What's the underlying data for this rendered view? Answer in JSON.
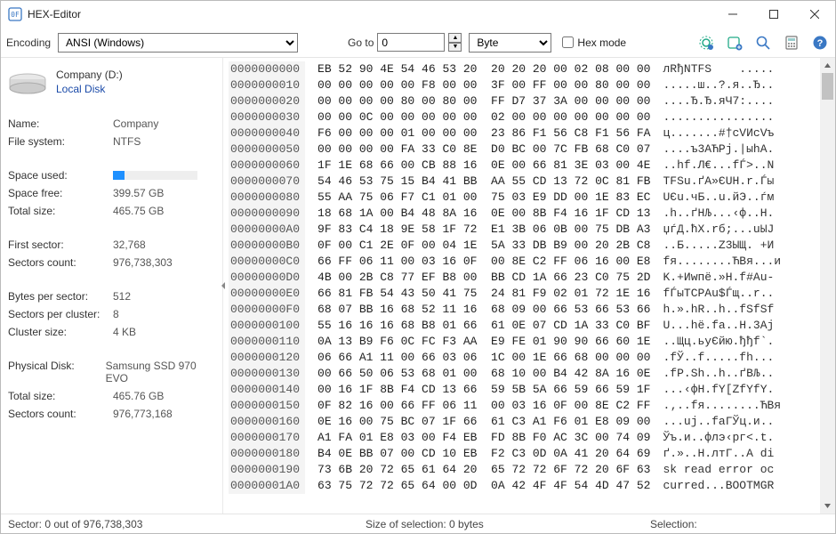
{
  "title": "HEX-Editor",
  "toolbar": {
    "encoding_label": "Encoding",
    "encoding_value": "ANSI (Windows)",
    "goto_label": "Go to",
    "goto_value": "0",
    "byte_value": "Byte",
    "hexmode_label": "Hex mode",
    "icons": {
      "settings": "settings-gear-icon",
      "settings2": "settings-plus-icon",
      "search": "search-icon",
      "calc": "calc-icon",
      "help": "help-icon"
    }
  },
  "left": {
    "disk_title": "Company (D:)",
    "disk_type": "Local Disk",
    "name_k": "Name:",
    "name_v": "Company",
    "fs_k": "File system:",
    "fs_v": "NTFS",
    "used_k": "Space used:",
    "used_pct": 14,
    "free_k": "Space free:",
    "free_v": "399.57 GB",
    "total_k": "Total size:",
    "total_v": "465.75 GB",
    "firstsec_k": "First sector:",
    "firstsec_v": "32,768",
    "seccount_k": "Sectors count:",
    "seccount_v": "976,738,303",
    "bps_k": "Bytes per sector:",
    "bps_v": "512",
    "spc_k": "Sectors per cluster:",
    "spc_v": "8",
    "cluster_k": "Cluster size:",
    "cluster_v": "4 KB",
    "phys_k": "Physical Disk:",
    "phys_v": "Samsung SSD 970 EVO",
    "phystotal_k": "Total size:",
    "phystotal_v": "465.76 GB",
    "physseccount_k": "Sectors count:",
    "physseccount_v": "976,773,168"
  },
  "hex": {
    "rows": [
      {
        "o": "0000000000",
        "b": "EB 52 90 4E 54 46 53 20  20 20 20 00 02 08 00 00",
        "a": "лRђNTFS    ....."
      },
      {
        "o": "0000000010",
        "b": "00 00 00 00 00 F8 00 00  3F 00 FF 00 00 80 00 00",
        "a": ".....ш..?.я..Ђ.."
      },
      {
        "o": "0000000020",
        "b": "00 00 00 00 80 00 80 00  FF D7 37 3A 00 00 00 00",
        "a": "....Ђ.Ђ.яЧ7:...."
      },
      {
        "o": "0000000030",
        "b": "00 00 0C 00 00 00 00 00  02 00 00 00 00 00 00 00",
        "a": "................"
      },
      {
        "o": "0000000040",
        "b": "F6 00 00 00 01 00 00 00  23 86 F1 56 C8 F1 56 FA",
        "a": "ц.......#†сVИсVъ"
      },
      {
        "o": "0000000050",
        "b": "00 00 00 00 FA 33 C0 8E  D0 BC 00 7C FB 68 C0 07",
        "a": "....ъ3АЋРј.|ыhА."
      },
      {
        "o": "0000000060",
        "b": "1F 1E 68 66 00 CB 88 16  0E 00 66 81 3E 03 00 4E",
        "a": "..hf.Л€...fЃ>..N"
      },
      {
        "o": "0000000070",
        "b": "54 46 53 75 15 B4 41 BB  AA 55 CD 13 72 0C 81 FB",
        "a": "TFSu.ґA»ЄUН.r.Ѓы"
      },
      {
        "o": "0000000080",
        "b": "55 AA 75 06 F7 C1 01 00  75 03 E9 DD 00 1E 83 EC",
        "a": "UЄu.чБ..u.йЭ..ѓм"
      },
      {
        "o": "0000000090",
        "b": "18 68 1A 00 B4 48 8A 16  0E 00 8B F4 16 1F CD 13",
        "a": ".h..ґHЉ...‹ф..Н."
      },
      {
        "o": "00000000A0",
        "b": "9F 83 C4 18 9E 58 1F 72  E1 3B 06 0B 00 75 DB A3",
        "a": "џѓД.ћX.rб;...uЫЈ"
      },
      {
        "o": "00000000B0",
        "b": "0F 00 C1 2E 0F 00 04 1E  5A 33 DB B9 00 20 2B C8",
        "a": "..Б.....Z3ЫЩ. +И"
      },
      {
        "o": "00000000C0",
        "b": "66 FF 06 11 00 03 16 0F  00 8E C2 FF 06 16 00 E8",
        "a": "fя........ЋВя...и"
      },
      {
        "o": "00000000D0",
        "b": "4B 00 2B C8 77 EF B8 00  BB CD 1A 66 23 C0 75 2D",
        "a": "K.+Иwпё.»Н.f#Аu-"
      },
      {
        "o": "00000000E0",
        "b": "66 81 FB 54 43 50 41 75  24 81 F9 02 01 72 1E 16",
        "a": "fЃыTCPAu$Ѓщ..r.."
      },
      {
        "o": "00000000F0",
        "b": "68 07 BB 16 68 52 11 16  68 09 00 66 53 66 53 66",
        "a": "h.».hR..h..fSfSf"
      },
      {
        "o": "0000000100",
        "b": "55 16 16 16 68 B8 01 66  61 0E 07 CD 1A 33 C0 BF",
        "a": "U...hё.fa..Н.3Ај"
      },
      {
        "o": "0000000110",
        "b": "0A 13 B9 F6 0C FC F3 AA  E9 FE 01 90 90 66 60 1E",
        "a": "..Щц.ьуЄйю.ђђf`."
      },
      {
        "o": "0000000120",
        "b": "06 66 A1 11 00 66 03 06  1C 00 1E 66 68 00 00 00",
        "a": ".fЎ..f.....fh..."
      },
      {
        "o": "0000000130",
        "b": "00 66 50 06 53 68 01 00  68 10 00 B4 42 8A 16 0E",
        "a": ".fP.Sh..h..ґBЉ.."
      },
      {
        "o": "0000000140",
        "b": "00 16 1F 8B F4 CD 13 66  59 5B 5A 66 59 66 59 1F",
        "a": "...‹фН.fY[ZfYfY."
      },
      {
        "o": "0000000150",
        "b": "0F 82 16 00 66 FF 06 11  00 03 16 0F 00 8E C2 FF",
        "a": ".‚..fя........ЋВя"
      },
      {
        "o": "0000000160",
        "b": "0E 16 00 75 BC 07 1F 66  61 C3 A1 F6 01 E8 09 00",
        "a": "...uј..faГЎц.и.."
      },
      {
        "o": "0000000170",
        "b": "A1 FA 01 E8 03 00 F4 EB  FD 8B F0 AC 3C 00 74 09",
        "a": "Ўъ.и..флэ‹рг<.t."
      },
      {
        "o": "0000000180",
        "b": "B4 0E BB 07 00 CD 10 EB  F2 C3 0D 0A 41 20 64 69",
        "a": "ґ.»..Н.лтГ..A di"
      },
      {
        "o": "0000000190",
        "b": "73 6B 20 72 65 61 64 20  65 72 72 6F 72 20 6F 63",
        "a": "sk read error oc"
      },
      {
        "o": "00000001A0",
        "b": "63 75 72 72 65 64 00 0D  0A 42 4F 4F 54 4D 47 52",
        "a": "curred...BOOTMGR"
      }
    ]
  },
  "status": {
    "sector": "Sector: 0 out of 976,738,303",
    "selection_size": "Size of selection: 0 bytes",
    "selection": "Selection:"
  }
}
